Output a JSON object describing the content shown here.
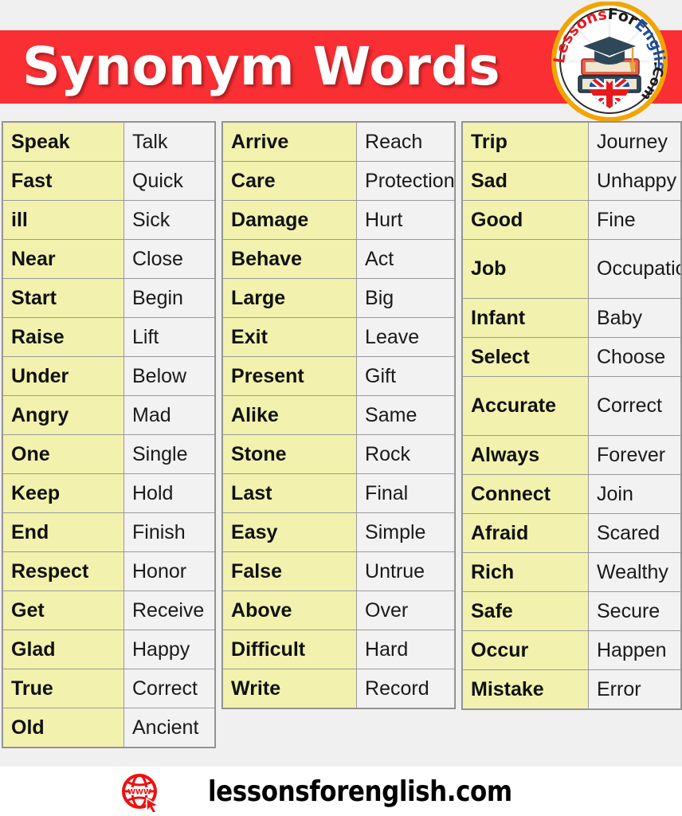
{
  "header": {
    "title": "Synonym Words",
    "banner_color": "#f92f34",
    "background_color": "#f0f0f0",
    "logo": {
      "name": "lessonsforenglish-logo",
      "text_segments": [
        "Lessons",
        "For",
        "English",
        ".Com"
      ],
      "text_full": "LessonsForEnglish.Com",
      "ring_color": "#f0a500",
      "red_text_color": "#e8191c",
      "blue_text_color": "#1d4fa0",
      "dark_text_color": "#1a1a1a",
      "elements": [
        "graduation-cap-icon",
        "book-stack-icon",
        "uk-flag-heart-icon"
      ]
    }
  },
  "table": {
    "word_cell_color": "#f2f2ae",
    "synonym_cell_color": "#f2f2f2",
    "border_color": "#9a9a9a",
    "columns": [
      {
        "id": "column-1",
        "rows": [
          {
            "word": "Speak",
            "synonym": "Talk",
            "tall": false
          },
          {
            "word": "Fast",
            "synonym": "Quick",
            "tall": false
          },
          {
            "word": "ill",
            "synonym": "Sick",
            "tall": false
          },
          {
            "word": "Near",
            "synonym": "Close",
            "tall": false
          },
          {
            "word": "Start",
            "synonym": "Begin",
            "tall": false
          },
          {
            "word": "Raise",
            "synonym": "Lift",
            "tall": false
          },
          {
            "word": "Under",
            "synonym": "Below",
            "tall": false
          },
          {
            "word": "Angry",
            "synonym": "Mad",
            "tall": false
          },
          {
            "word": "One",
            "synonym": "Single",
            "tall": false
          },
          {
            "word": "Keep",
            "synonym": "Hold",
            "tall": false
          },
          {
            "word": "End",
            "synonym": "Finish",
            "tall": false
          },
          {
            "word": "Respect",
            "synonym": "Honor",
            "tall": false
          },
          {
            "word": "Get",
            "synonym": "Receive",
            "tall": false
          },
          {
            "word": "Glad",
            "synonym": "Happy",
            "tall": false
          },
          {
            "word": "True",
            "synonym": "Correct",
            "tall": false
          },
          {
            "word": "Old",
            "synonym": "Ancient",
            "tall": false
          }
        ]
      },
      {
        "id": "column-2",
        "rows": [
          {
            "word": "Arrive",
            "synonym": "Reach",
            "tall": false
          },
          {
            "word": "Care",
            "synonym": "Protection",
            "tall": false
          },
          {
            "word": "Damage",
            "synonym": "Hurt",
            "tall": false
          },
          {
            "word": "Behave",
            "synonym": "Act",
            "tall": false
          },
          {
            "word": "Large",
            "synonym": "Big",
            "tall": false
          },
          {
            "word": "Exit",
            "synonym": "Leave",
            "tall": false
          },
          {
            "word": "Present",
            "synonym": "Gift",
            "tall": false
          },
          {
            "word": "Alike",
            "synonym": "Same",
            "tall": false
          },
          {
            "word": "Stone",
            "synonym": "Rock",
            "tall": false
          },
          {
            "word": "Last",
            "synonym": "Final",
            "tall": false
          },
          {
            "word": "Easy",
            "synonym": "Simple",
            "tall": false
          },
          {
            "word": "False",
            "synonym": "Untrue",
            "tall": false
          },
          {
            "word": "Above",
            "synonym": "Over",
            "tall": false
          },
          {
            "word": "Difficult",
            "synonym": "Hard",
            "tall": false
          },
          {
            "word": "Write",
            "synonym": "Record",
            "tall": false
          }
        ]
      },
      {
        "id": "column-3",
        "rows": [
          {
            "word": "Trip",
            "synonym": "Journey",
            "tall": false
          },
          {
            "word": "Sad",
            "synonym": "Unhappy",
            "tall": false
          },
          {
            "word": "Good",
            "synonym": "Fine",
            "tall": false
          },
          {
            "word": "Job",
            "synonym": "Occupation",
            "tall": true
          },
          {
            "word": "Infant",
            "synonym": "Baby",
            "tall": false
          },
          {
            "word": "Select",
            "synonym": "Choose",
            "tall": false
          },
          {
            "word": "Accurate",
            "synonym": "Correct",
            "tall": true
          },
          {
            "word": "Always",
            "synonym": "Forever",
            "tall": false
          },
          {
            "word": "Connect",
            "synonym": "Join",
            "tall": false
          },
          {
            "word": "Afraid",
            "synonym": "Scared",
            "tall": false
          },
          {
            "word": "Rich",
            "synonym": "Wealthy",
            "tall": false
          },
          {
            "word": "Safe",
            "synonym": "Secure",
            "tall": false
          },
          {
            "word": "Occur",
            "synonym": "Happen",
            "tall": false
          },
          {
            "word": "Mistake",
            "synonym": "Error",
            "tall": false
          }
        ]
      }
    ]
  },
  "footer": {
    "site": "lessonsforenglish.com",
    "icon": "www-globe-cursor-icon",
    "icon_color": "#ee1111"
  }
}
